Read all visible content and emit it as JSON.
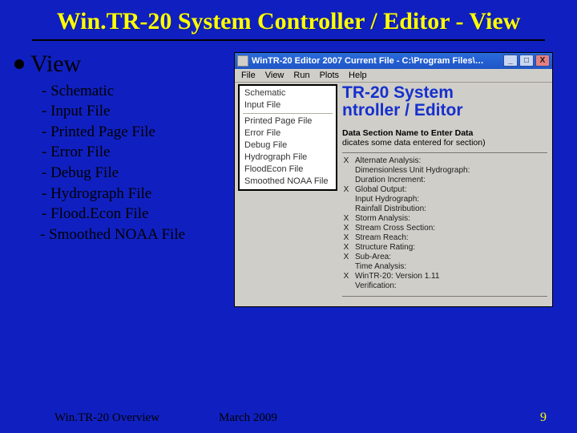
{
  "title": "Win.TR-20 System Controller / Editor - View",
  "bullet_heading": "View",
  "sublist": [
    "Schematic",
    "Input File",
    "Printed Page File",
    "Error File",
    "Debug File",
    "Hydrograph File",
    "Flood.Econ File",
    " Smoothed NOAA File"
  ],
  "window": {
    "title": "WinTR-20 Editor 2007   Current File - C:\\Program Files\\…",
    "btn_min": "_",
    "btn_max": "□",
    "btn_close": "X",
    "menubar": [
      "File",
      "View",
      "Run",
      "Plots",
      "Help"
    ],
    "options": [
      "Schematic",
      "Input File",
      "Printed Page File",
      "Error File",
      "Debug File",
      "Hydrograph File",
      "FloodEcon File",
      "Smoothed NOAA File"
    ],
    "app_title_1": "TR-20 System",
    "app_title_2": "ntroller / Editor",
    "instr": "Data Section Name to Enter Data",
    "instr2": "dicates some data entered for section)",
    "sections": [
      {
        "x": "X",
        "name": "Alternate Analysis:"
      },
      {
        "x": "",
        "name": "Dimensionless Unit Hydrograph:"
      },
      {
        "x": "",
        "name": "Duration Increment:"
      },
      {
        "x": "X",
        "name": "Global Output:"
      },
      {
        "x": "",
        "name": "Input Hydrograph:"
      },
      {
        "x": "",
        "name": "Rainfall Distribution:"
      },
      {
        "x": "X",
        "name": "Storm Analysis:"
      },
      {
        "x": "X",
        "name": "Stream Cross Section:"
      },
      {
        "x": "X",
        "name": "Stream Reach:"
      },
      {
        "x": "X",
        "name": "Structure Rating:"
      },
      {
        "x": "X",
        "name": "Sub-Area:"
      },
      {
        "x": "",
        "name": "Time Analysis:"
      },
      {
        "x": "X",
        "name": "WinTR-20: Version 1.11"
      },
      {
        "x": "",
        "name": "Verification:"
      }
    ]
  },
  "footer": {
    "left": "Win.TR-20 Overview",
    "center": "March 2009"
  },
  "slide_no": "9"
}
